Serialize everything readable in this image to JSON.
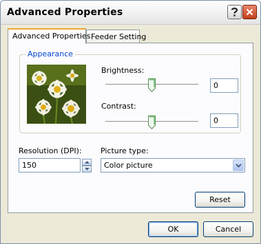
{
  "window": {
    "title": "Advanced Properties",
    "help_icon": "question-icon",
    "close_icon": "close-icon"
  },
  "tabs": [
    {
      "label": "Advanced Properties",
      "active": true
    },
    {
      "label": "Feeder Setting",
      "active": false
    }
  ],
  "appearance": {
    "group_label": "Appearance",
    "preview_alt": "flower-preview-image",
    "brightness": {
      "label": "Brightness:",
      "value": "0",
      "slider_fraction": 0.5
    },
    "contrast": {
      "label": "Contrast:",
      "value": "0",
      "slider_fraction": 0.5
    }
  },
  "resolution": {
    "label": "Resolution (DPI):",
    "value": "150"
  },
  "picture_type": {
    "label": "Picture type:",
    "selected": "Color picture"
  },
  "buttons": {
    "reset": "Reset",
    "ok": "OK",
    "cancel": "Cancel"
  },
  "colors": {
    "accent_blue": "#0046d5",
    "tab_highlight": "#f0a632",
    "close_red": "#c2401c"
  }
}
